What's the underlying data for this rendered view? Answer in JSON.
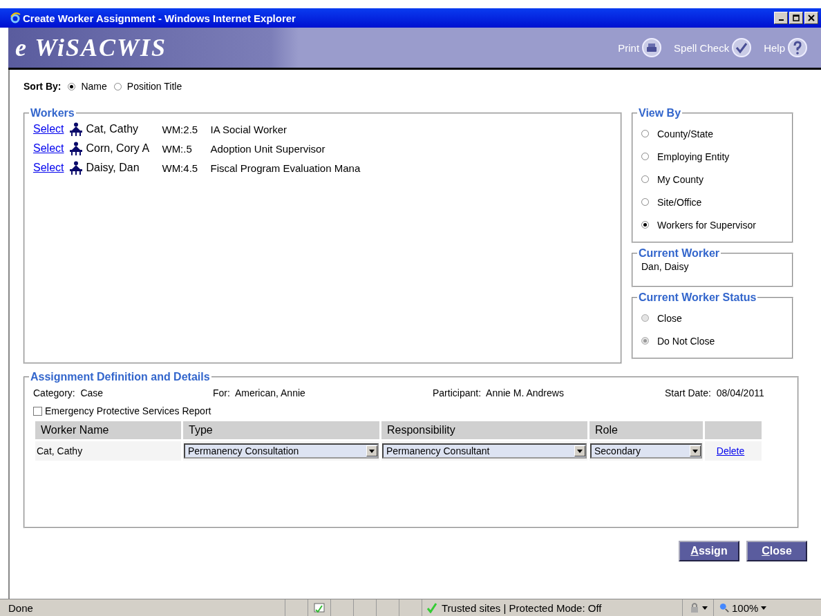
{
  "window": {
    "title": "Create Worker Assignment - Windows Internet Explorer"
  },
  "header": {
    "logo": "e WiSACWIS",
    "actions": [
      {
        "label": "Print",
        "kind": "print"
      },
      {
        "label": "Spell Check",
        "kind": "spell"
      },
      {
        "label": "Help",
        "kind": "help"
      }
    ]
  },
  "sort_by": {
    "label": "Sort By:",
    "options": [
      {
        "label": "Name",
        "selected": true
      },
      {
        "label": "Position Title",
        "selected": false
      }
    ]
  },
  "workers": {
    "title": "Workers",
    "rows": [
      {
        "link": "Select",
        "name": "Cat, Cathy",
        "wm": "WM:2.5",
        "position": "IA Social Worker"
      },
      {
        "link": "Select",
        "name": "Corn, Cory A",
        "wm": "WM:.5",
        "position": "Adoption Unit Supervisor"
      },
      {
        "link": "Select",
        "name": "Daisy, Dan",
        "wm": "WM:4.5",
        "position": "Fiscal Program Evaluation Mana"
      }
    ]
  },
  "view_by": {
    "title": "View By",
    "options": [
      {
        "label": "County/State",
        "selected": false
      },
      {
        "label": "Employing Entity",
        "selected": false
      },
      {
        "label": "My County",
        "selected": false
      },
      {
        "label": "Site/Office",
        "selected": false
      },
      {
        "label": "Workers for Supervisor",
        "selected": true
      }
    ]
  },
  "current_worker": {
    "title": "Current Worker",
    "value": "Dan, Daisy"
  },
  "current_worker_status": {
    "title": "Current Worker Status",
    "options": [
      {
        "label": "Close",
        "selected": false,
        "disabled": true
      },
      {
        "label": "Do Not Close",
        "selected": true,
        "disabled": true
      }
    ]
  },
  "assignment": {
    "title": "Assignment Definition and Details",
    "fields": [
      {
        "label": "Category:",
        "value": "Case"
      },
      {
        "label": "For:",
        "value": "American, Annie"
      },
      {
        "label": "Participant:",
        "value": "Annie M. Andrews"
      },
      {
        "label": "Start Date:",
        "value": "08/04/2011"
      }
    ],
    "emergency": {
      "label": "Emergency Protective Services Report",
      "checked": false
    },
    "table": {
      "columns": [
        "Worker Name",
        "Type",
        "Responsibility",
        "Role"
      ],
      "rows": [
        {
          "worker_name": "Cat, Cathy",
          "type": "Permanency Consultation",
          "responsibility": "Permanency Consultant",
          "role": "Secondary",
          "action": "Delete"
        }
      ]
    }
  },
  "buttons": [
    "Assign",
    "Close"
  ],
  "status_bar": {
    "text": "Done",
    "zone": "Trusted sites | Protected Mode: Off",
    "zoom": "100%"
  }
}
